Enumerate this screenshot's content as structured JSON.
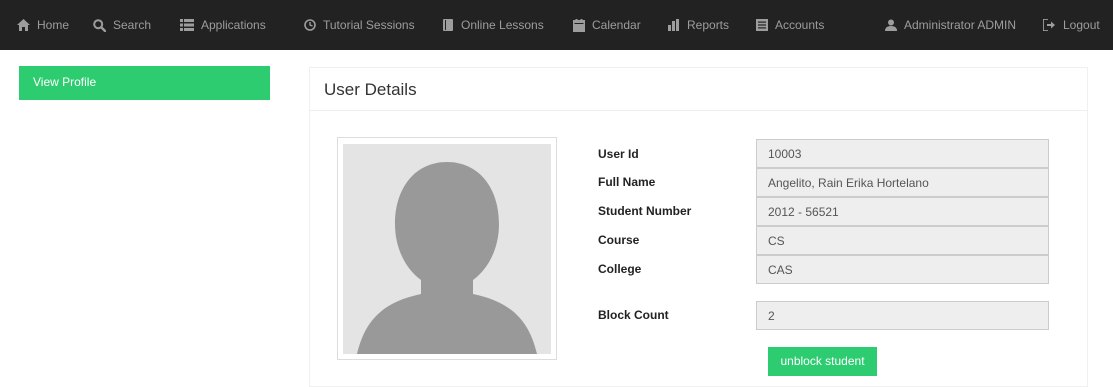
{
  "nav": {
    "home": "Home",
    "search": "Search",
    "applications": "Applications",
    "tutorial_sessions": "Tutorial Sessions",
    "online_lessons": "Online Lessons",
    "calendar": "Calendar",
    "reports": "Reports",
    "accounts": "Accounts",
    "user": "Administrator ADMIN",
    "logout": "Logout"
  },
  "sidebar": {
    "view_profile": "View Profile"
  },
  "panel": {
    "title": "User Details"
  },
  "user": {
    "user_id_label": "User Id",
    "user_id": "10003",
    "full_name_label": "Full Name",
    "full_name": "Angelito, Rain Erika Hortelano",
    "student_number_label": "Student Number",
    "student_number": "2012 - 56521",
    "course_label": "Course",
    "course": "CS",
    "college_label": "College",
    "college": "CAS",
    "block_count_label": "Block Count",
    "block_count": "2"
  },
  "actions": {
    "unblock": "unblock student"
  },
  "colors": {
    "navbar_bg": "#222222",
    "nav_text": "#9d9d9d",
    "accent_green": "#2ecc71",
    "field_bg": "#eeeeee"
  }
}
